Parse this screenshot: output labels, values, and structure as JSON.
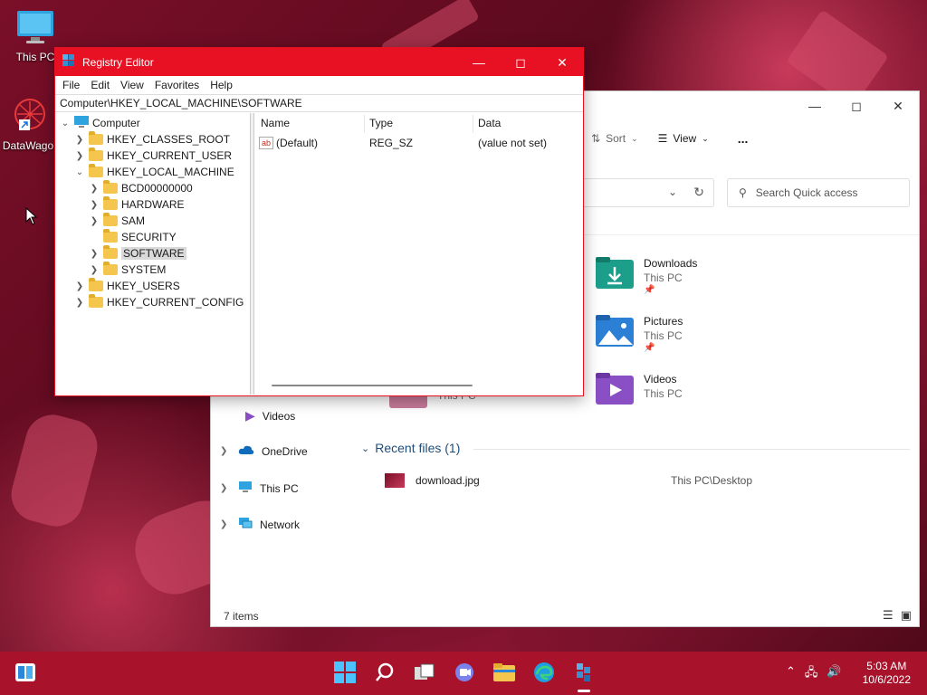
{
  "desktop": {
    "icons": [
      {
        "label": "This PC"
      },
      {
        "label": "DataWago"
      }
    ]
  },
  "regedit": {
    "title": "Registry Editor",
    "menu": [
      "File",
      "Edit",
      "View",
      "Favorites",
      "Help"
    ],
    "path": "Computer\\HKEY_LOCAL_MACHINE\\SOFTWARE",
    "tree": {
      "root": "Computer",
      "nodes": [
        "HKEY_CLASSES_ROOT",
        "HKEY_CURRENT_USER",
        "HKEY_LOCAL_MACHINE",
        "BCD00000000",
        "HARDWARE",
        "SAM",
        "SECURITY",
        "SOFTWARE",
        "SYSTEM",
        "HKEY_USERS",
        "HKEY_CURRENT_CONFIG"
      ]
    },
    "columns": {
      "name": "Name",
      "type": "Type",
      "data": "Data"
    },
    "values": [
      {
        "name": "(Default)",
        "type": "REG_SZ",
        "data": "(value not set)"
      }
    ]
  },
  "explorer": {
    "cmdbar": {
      "sort": "Sort",
      "view": "View",
      "more": "..."
    },
    "search_placeholder": "Search Quick access",
    "quick_access": [
      {
        "label": "Downloads",
        "sub": "This PC"
      },
      {
        "label": "Pictures",
        "sub": "This PC"
      },
      {
        "label": "Videos",
        "sub": "This PC"
      },
      {
        "label": "",
        "sub": "This PC"
      }
    ],
    "nav": {
      "videos": "Videos",
      "onedrive": "OneDrive",
      "thispc": "This PC",
      "network": "Network"
    },
    "recent_header": "Recent files (1)",
    "recent_files": [
      {
        "name": "download.jpg",
        "location": "This PC\\Desktop"
      }
    ],
    "status": "7 items"
  },
  "taskbar": {
    "time": "5:03 AM",
    "date": "10/6/2022"
  },
  "colors": {
    "accent_red": "#e81123",
    "taskbar": "#a9122b"
  }
}
